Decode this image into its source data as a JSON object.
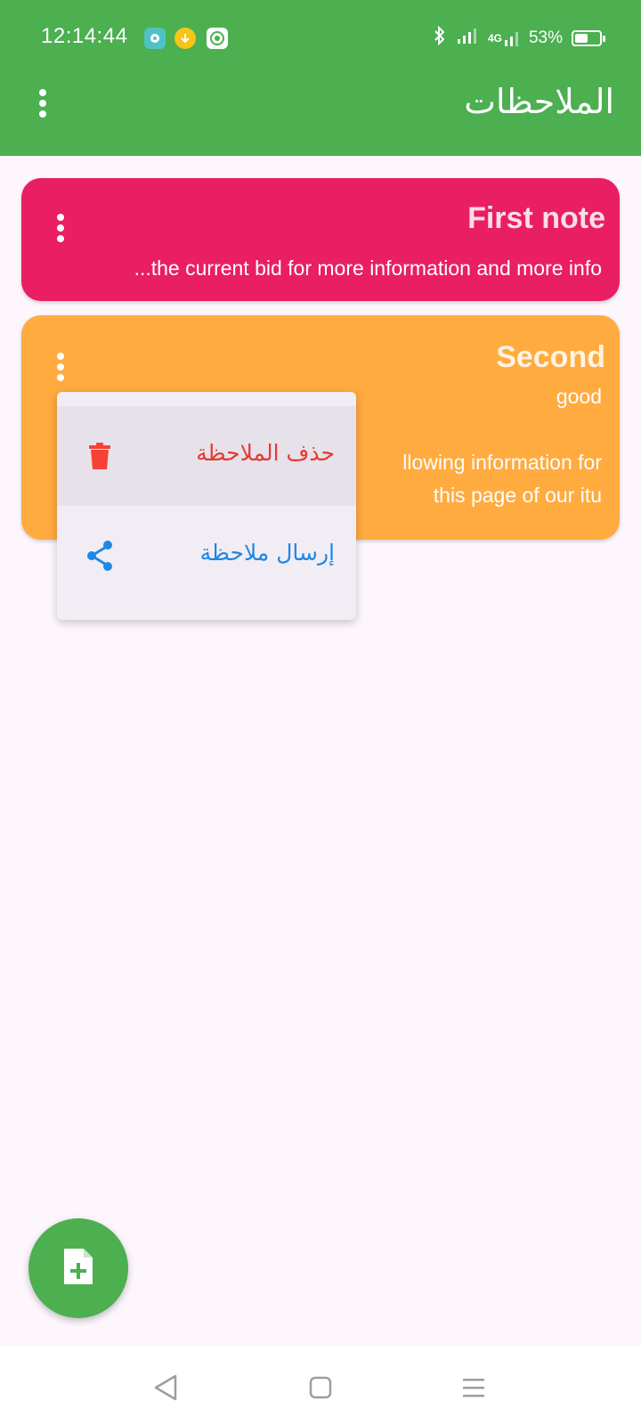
{
  "status_bar": {
    "time": "12:14:44",
    "network": "4G",
    "battery": "53%",
    "battery_level": 0.53,
    "icons": [
      "chat-app-icon",
      "download-app-icon",
      "quran-app-icon",
      "bluetooth-icon",
      "signal-icon",
      "signal-4g-icon",
      "battery-icon"
    ]
  },
  "app_bar": {
    "title": "الملاحظات",
    "menu_icon": "more-vert-icon"
  },
  "notes": [
    {
      "title": "First note",
      "body": "...the current bid for more information and more info",
      "color": "#e91e63"
    },
    {
      "title": "Second",
      "lines": [
        "good",
        "",
        "llowing information for",
        "this page of our itu"
      ],
      "color": "#ffab40"
    }
  ],
  "popup_menu": {
    "items": [
      {
        "label": "حذف الملاحظة",
        "icon": "trash-icon",
        "color": "#e53935"
      },
      {
        "label": "إرسال ملاحظة",
        "icon": "share-icon",
        "color": "#1e88e5"
      }
    ]
  },
  "fab": {
    "icon": "add-note-icon",
    "color": "#4caf50"
  },
  "nav_bar": {
    "icons": [
      "back-icon",
      "home-icon",
      "recents-icon"
    ]
  },
  "colors": {
    "primary": "#4caf50",
    "background": "#fdf7fd"
  }
}
